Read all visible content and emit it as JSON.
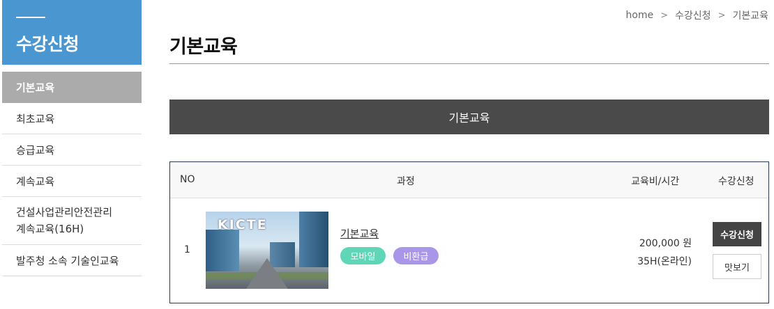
{
  "sidebar": {
    "title": "수강신청",
    "items": [
      {
        "label": "기본교육"
      },
      {
        "label": "최초교육"
      },
      {
        "label": "승급교육"
      },
      {
        "label": "계속교육"
      },
      {
        "label": "건설사업관리안전관리\n계속교육(16H)"
      },
      {
        "label": "발주청 소속 기술인교육"
      }
    ],
    "active_index": 0
  },
  "breadcrumb": {
    "items": [
      "home",
      "수강신청",
      "기본교육"
    ]
  },
  "page": {
    "title": "기본교육",
    "section_label": "기본교육"
  },
  "table": {
    "headers": {
      "no": "NO",
      "course": "과정",
      "fee": "교육비/시간",
      "apply": "수강신청"
    },
    "rows": [
      {
        "no": "1",
        "thumbnail_text": "KICTE",
        "course_name": "기본교육",
        "badges": [
          "모바일",
          "비환급"
        ],
        "fee": "200,000 원",
        "hours": "35H(온라인)",
        "apply_label": "수강신청",
        "preview_label": "맛보기"
      }
    ]
  },
  "colors": {
    "sidebar_header": "#4a96d1",
    "active_item": "#ababab",
    "section_bar": "#4a4a4a",
    "badge_mobile": "#5fd6b5",
    "badge_norefund": "#a996e8",
    "apply_button": "#444444"
  }
}
